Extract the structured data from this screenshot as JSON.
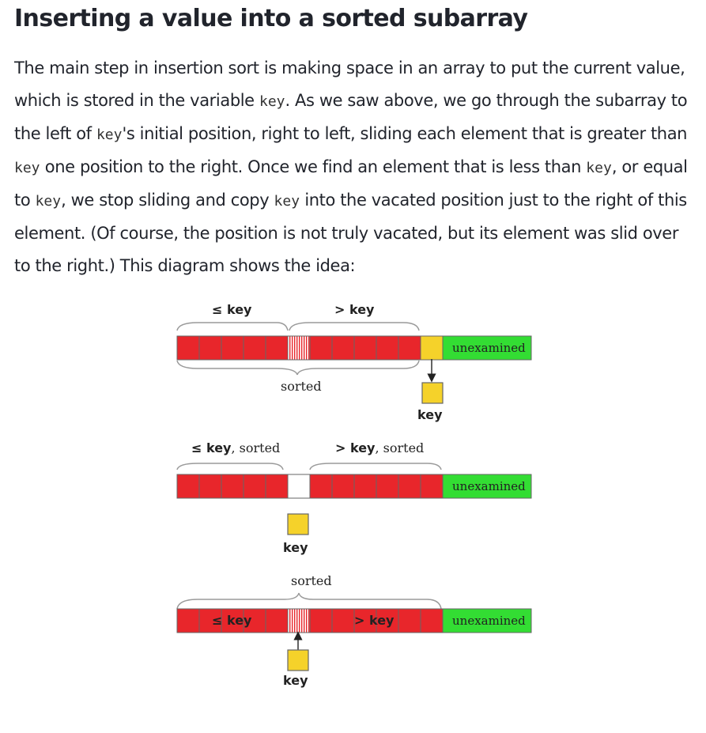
{
  "heading": "Inserting a value into a sorted subarray",
  "paragraph": [
    {
      "t": "The main step in insertion sort is making space in an array to put the current value, which is stored in the variable "
    },
    {
      "c": "key"
    },
    {
      "t": ". As we saw above, we go through the subarray to the left of "
    },
    {
      "c": "key"
    },
    {
      "t": "'s initial position, right to left, sliding each element that is greater than "
    },
    {
      "c": "key"
    },
    {
      "t": " one position to the right. Once we find an element that is less than "
    },
    {
      "c": "key"
    },
    {
      "t": ", or equal to "
    },
    {
      "c": "key"
    },
    {
      "t": ", we stop sliding and copy "
    },
    {
      "c": "key"
    },
    {
      "t": " into the vacated position just to the right of this element. (Of course, the position is not truly vacated, but its element was slid over to the right.) This diagram shows the idea:"
    }
  ],
  "diagram": {
    "colors": {
      "sorted": "#e8262b",
      "unexamined": "#33dd33",
      "key": "#f5d22a",
      "outline": "#666666",
      "brace": "#9a9a9a"
    },
    "panel1": {
      "le_label": "≤ key",
      "gt_label": "> key",
      "sorted_label": "sorted",
      "unexamined_label": "unexamined",
      "key_label": "key"
    },
    "panel2": {
      "le_label": "≤ key",
      "le_suffix": ", sorted",
      "gt_label": "> key",
      "gt_suffix": ", sorted",
      "unexamined_label": "unexamined",
      "key_label": "key"
    },
    "panel3": {
      "sorted_label": "sorted",
      "le_label": "≤ key",
      "gt_label": "> key",
      "unexamined_label": "unexamined",
      "key_label": "key"
    }
  }
}
